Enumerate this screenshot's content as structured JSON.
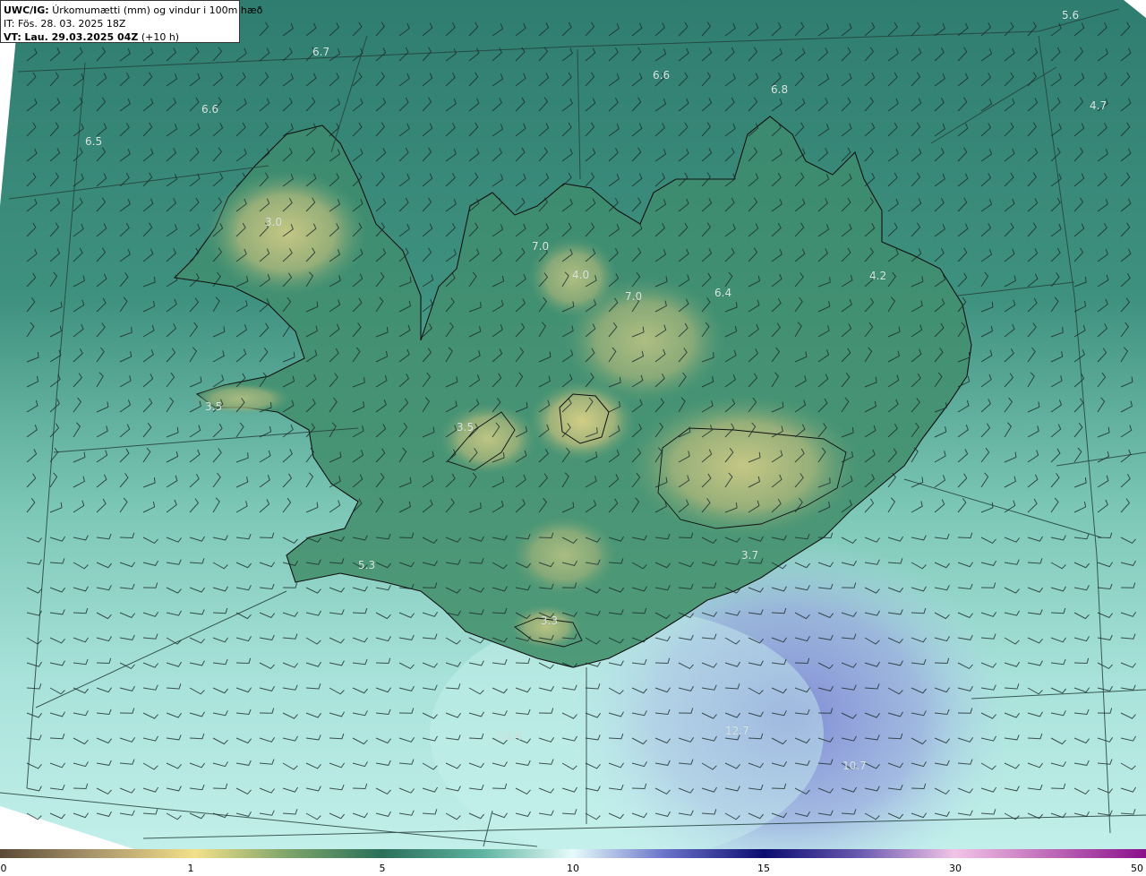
{
  "header": {
    "model_label": "UWC/IG:",
    "title": "Úrkomumætti (mm) og vindur i 100m hæð",
    "init_label": "IT:",
    "init_time": "Fös. 28. 03. 2025 18Z",
    "valid_label": "VT:",
    "valid_time": "Lau. 29.03.2025 04Z",
    "lead": "(+10 h)"
  },
  "map_values": [
    {
      "text": "5.6"
    },
    {
      "text": "6.7"
    },
    {
      "text": "6.6"
    },
    {
      "text": "6.8"
    },
    {
      "text": "4.7"
    },
    {
      "text": "6.6"
    },
    {
      "text": "6.5"
    },
    {
      "text": "3.0"
    },
    {
      "text": "7.0"
    },
    {
      "text": "4.0"
    },
    {
      "text": "7.0"
    },
    {
      "text": "6.4"
    },
    {
      "text": "4.2"
    },
    {
      "text": "3.5"
    },
    {
      "text": "3.5"
    },
    {
      "text": "3.7"
    },
    {
      "text": "5.3"
    },
    {
      "text": "3.3"
    },
    {
      "text": "10.4"
    },
    {
      "text": "12.7"
    },
    {
      "text": "10.7"
    }
  ],
  "colorbar": {
    "ticks": [
      "0",
      "1",
      "5",
      "10",
      "15",
      "30",
      "50"
    ]
  },
  "colors": {
    "ocean_north": "#2f7f72",
    "ocean_south": "#aee8e2",
    "land_low": "#3f8f6f",
    "land_high": "#c9c884",
    "precip_high": "#7f86d6"
  }
}
